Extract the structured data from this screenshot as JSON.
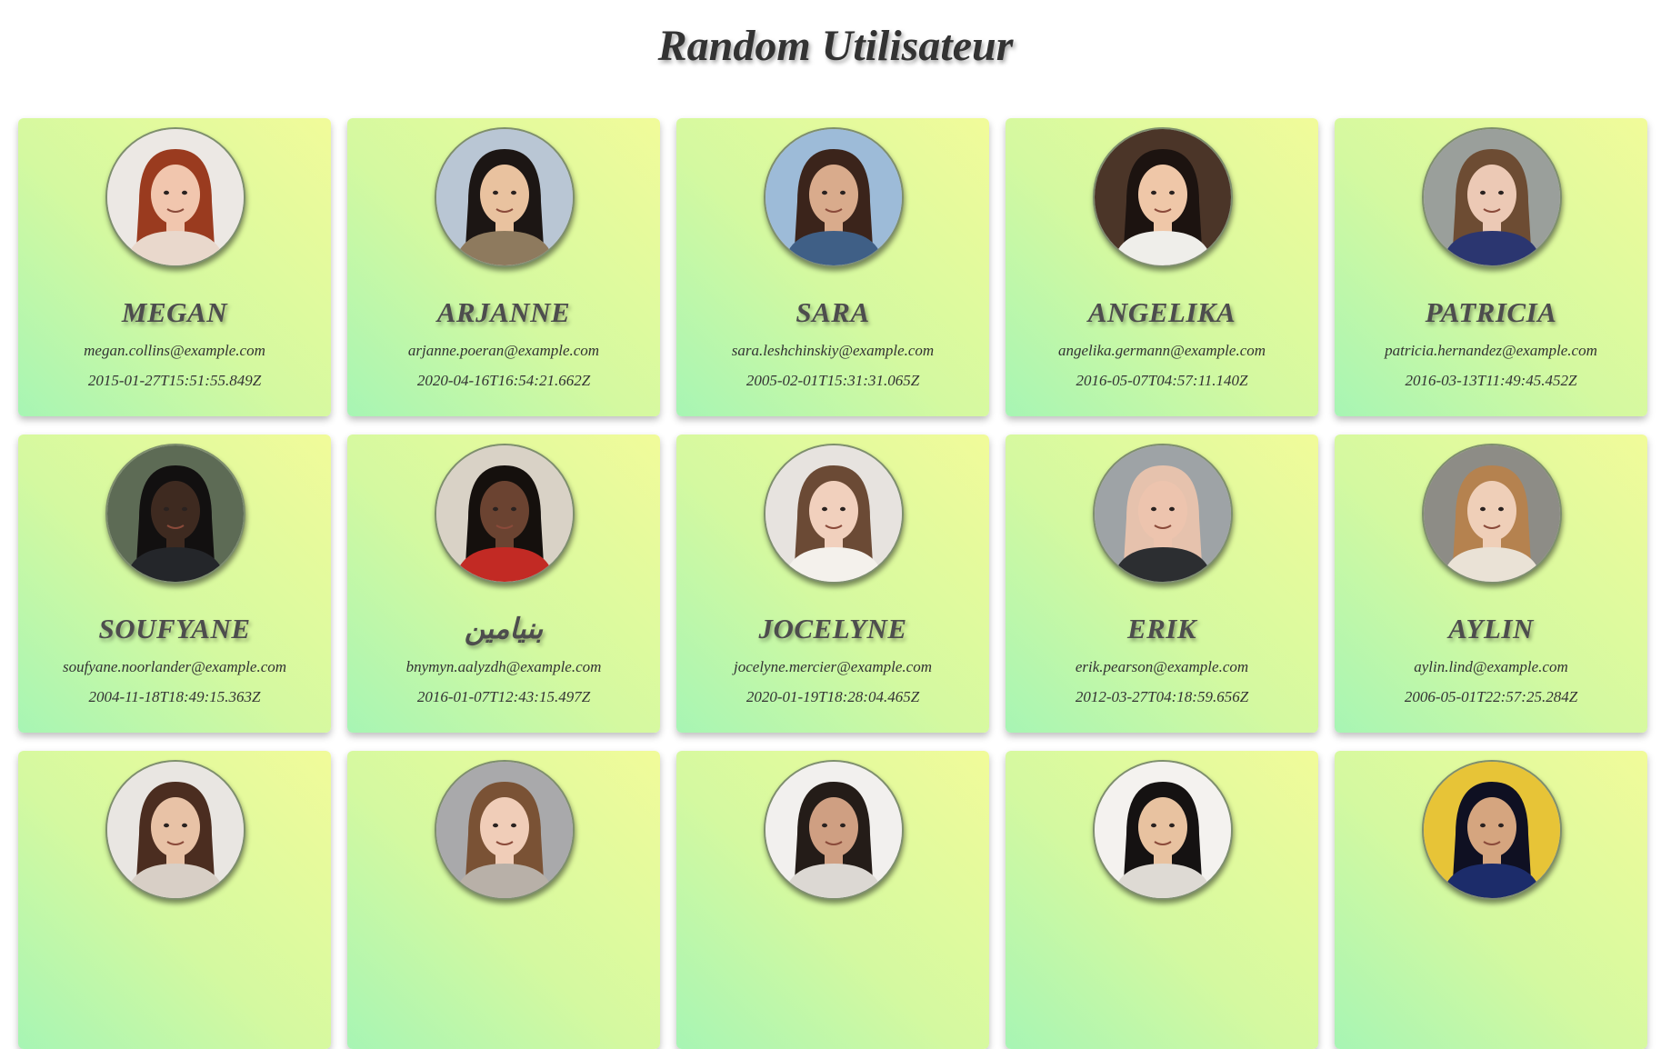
{
  "page": {
    "title": "Random Utilisateur"
  },
  "users": [
    {
      "name": "MEGAN",
      "email": "megan.collins@example.com",
      "registered": "2015-01-27T15:51:55.849Z",
      "photo_bg": "#ece8e4",
      "hair": "#9a3b1f",
      "skin": "#f1c6ae",
      "shirt": "#e9d8cc"
    },
    {
      "name": "ARJANNE",
      "email": "arjanne.poeran@example.com",
      "registered": "2020-04-16T16:54:21.662Z",
      "photo_bg": "#b9c6d4",
      "hair": "#1c1614",
      "skin": "#e9c29f",
      "shirt": "#8e7a5e"
    },
    {
      "name": "SARA",
      "email": "sara.leshchinskiy@example.com",
      "registered": "2005-02-01T15:31:31.065Z",
      "photo_bg": "#9dbbd8",
      "hair": "#3b241b",
      "skin": "#d9ab8c",
      "shirt": "#3f5f86"
    },
    {
      "name": "ANGELIKA",
      "email": "angelika.germann@example.com",
      "registered": "2016-05-07T04:57:11.140Z",
      "photo_bg": "#4b3528",
      "hair": "#1c1310",
      "skin": "#efc7a8",
      "shirt": "#efeeea"
    },
    {
      "name": "PATRICIA",
      "email": "patricia.hernandez@example.com",
      "registered": "2016-03-13T11:49:45.452Z",
      "photo_bg": "#9a9f9b",
      "hair": "#6d4c33",
      "skin": "#ecc9b5",
      "shirt": "#2b3670"
    },
    {
      "name": "SOUFYANE",
      "email": "soufyane.noorlander@example.com",
      "registered": "2004-11-18T18:49:15.363Z",
      "photo_bg": "#5d6b55",
      "hair": "#121010",
      "skin": "#3e2a20",
      "shirt": "#24262a"
    },
    {
      "name": "بنيامين",
      "email": "bnymyn.aalyzdh@example.com",
      "registered": "2016-01-07T12:43:15.497Z",
      "photo_bg": "#d9d2c6",
      "hair": "#15100d",
      "skin": "#6b4331",
      "shirt": "#c22a24"
    },
    {
      "name": "JOCELYNE",
      "email": "jocelyne.mercier@example.com",
      "registered": "2020-01-19T18:28:04.465Z",
      "photo_bg": "#e7e3df",
      "hair": "#6b4a35",
      "skin": "#f1d0bd",
      "shirt": "#f4f1ec"
    },
    {
      "name": "ERIK",
      "email": "erik.pearson@example.com",
      "registered": "2012-03-27T04:18:59.656Z",
      "photo_bg": "#9ea3a6",
      "hair": "#e6c2ad",
      "skin": "#edc4ae",
      "shirt": "#2c2e31"
    },
    {
      "name": "AYLIN",
      "email": "aylin.lind@example.com",
      "registered": "2006-05-01T22:57:25.284Z",
      "photo_bg": "#8d8c86",
      "hair": "#b5824f",
      "skin": "#efcfb8",
      "shirt": "#eae2d6"
    },
    {
      "name": "",
      "email": "",
      "registered": "",
      "photo_bg": "#e9e6e2",
      "hair": "#4b2d20",
      "skin": "#e8c2a6",
      "shirt": "#d8cfc6"
    },
    {
      "name": "",
      "email": "",
      "registered": "",
      "photo_bg": "#a9a9ab",
      "hair": "#7a5235",
      "skin": "#f0cdb8",
      "shirt": "#b8b0a8"
    },
    {
      "name": "",
      "email": "",
      "registered": "",
      "photo_bg": "#f2f0ee",
      "hair": "#241c18",
      "skin": "#cf9f82",
      "shirt": "#dcd8d3"
    },
    {
      "name": "",
      "email": "",
      "registered": "",
      "photo_bg": "#f4f2ef",
      "hair": "#151212",
      "skin": "#e8c2a0",
      "shirt": "#dedad4"
    },
    {
      "name": "",
      "email": "",
      "registered": "",
      "photo_bg": "#e7c437",
      "hair": "#0f1022",
      "skin": "#d5a57f",
      "shirt": "#1c2c6a"
    }
  ]
}
